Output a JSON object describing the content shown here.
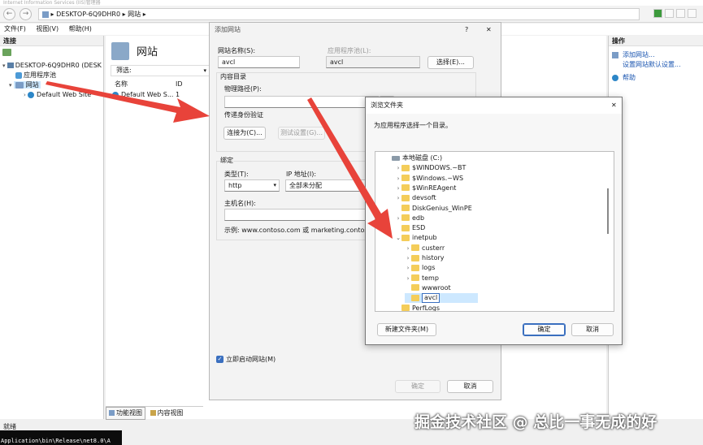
{
  "window": {
    "title": "Internet Information Services (IIS)管理器"
  },
  "address": {
    "segments": [
      "DESKTOP-6Q9DHR0",
      "网站"
    ]
  },
  "menu": [
    "文件(F)",
    "视图(V)",
    "帮助(H)"
  ],
  "connections": {
    "header": "连接",
    "tree": [
      {
        "label": "DESKTOP-6Q9DHR0 (DESK"
      },
      {
        "label": "应用程序池"
      },
      {
        "label": "网站"
      },
      {
        "label": "Default Web Site"
      }
    ]
  },
  "sites": {
    "title": "网站",
    "filter_label": "筛选:",
    "columns": {
      "name": "名称",
      "id": "ID"
    },
    "rows": [
      {
        "name": "Default Web S...",
        "id": "1"
      }
    ],
    "bottom_tabs": [
      "功能视图",
      "内容视图"
    ]
  },
  "actions": {
    "header": "操作",
    "items": [
      "添加网站...",
      "设置网站默认设置...",
      "帮助"
    ]
  },
  "status": {
    "text": "就绪"
  },
  "terminal": {
    "lines": [
      "",
      "Application\\bin\\Release\\net8.0\\A"
    ]
  },
  "add_site_dialog": {
    "title": "添加网站",
    "help": "?",
    "site_name_label": "网站名称(S):",
    "site_name_value": "avcl",
    "app_pool_label": "应用程序池(L):",
    "app_pool_value": "avcl",
    "select_button": "选择(E)...",
    "content_dir_label": "内容目录",
    "physical_path_label": "物理路径(P):",
    "physical_path_value": "",
    "browse_button": "...",
    "pass_auth_label": "传递身份验证",
    "connect_as_button": "连接为(C)...",
    "test_settings_button": "测试设置(G)...",
    "binding_label": "绑定",
    "type_label": "类型(T):",
    "type_value": "http",
    "ip_label": "IP 地址(I):",
    "ip_value": "全部未分配",
    "host_label": "主机名(H):",
    "host_value": "",
    "example_text": "示例: www.contoso.com 或 marketing.contoso.com",
    "start_immediately_label": "立即启动网站(M)",
    "start_immediately_checked": true,
    "ok_button": "确定",
    "cancel_button": "取消"
  },
  "browse_dialog": {
    "title": "浏览文件夹",
    "prompt": "为应用程序选择一个目录。",
    "tree": [
      {
        "label": "本地磁盘 (C:)",
        "level": 0,
        "icon": "drive-icon",
        "expanded": true
      },
      {
        "label": "$WINDOWS.~BT",
        "level": 1,
        "expander": true
      },
      {
        "label": "$Windows.~WS",
        "level": 1,
        "expander": true
      },
      {
        "label": "$WinREAgent",
        "level": 1,
        "expander": true
      },
      {
        "label": "devsoft",
        "level": 1,
        "expander": true
      },
      {
        "label": "DiskGenius_WinPE",
        "level": 1,
        "expander": false
      },
      {
        "label": "edb",
        "level": 1,
        "expander": true
      },
      {
        "label": "ESD",
        "level": 1,
        "expander": false
      },
      {
        "label": "inetpub",
        "level": 1,
        "expander": true,
        "expanded": true
      },
      {
        "label": "custerr",
        "level": 2,
        "expander": true
      },
      {
        "label": "history",
        "level": 2,
        "expander": true
      },
      {
        "label": "logs",
        "level": 2,
        "expander": true
      },
      {
        "label": "temp",
        "level": 2,
        "expander": true
      },
      {
        "label": "wwwroot",
        "level": 2,
        "expander": false
      },
      {
        "label": "avcl",
        "level": 2,
        "expander": false,
        "editing": true
      },
      {
        "label": "PerfLogs",
        "level": 1,
        "expander": false
      }
    ],
    "new_folder_button": "新建文件夹(M)",
    "ok_button": "确定",
    "cancel_button": "取消"
  },
  "watermark": "掘金技术社区 @ 总比一事无成的好",
  "colors": {
    "arrow": "#e8433a",
    "selection": "#cde8ff",
    "link": "#1a55b0",
    "folder": "#f4cd5a"
  }
}
